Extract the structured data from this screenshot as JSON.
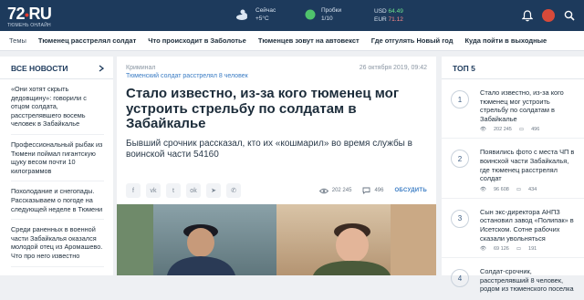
{
  "header": {
    "logo_num": "72",
    "logo_dot": "•",
    "logo_ru": "RU",
    "logo_sub": "ТЮМЕНЬ ОНЛАЙН",
    "weather_label": "Сейчас",
    "weather_temp": "+5°С",
    "traffic_label": "Пробки",
    "traffic_value": "1/10",
    "usd_label": "USD",
    "usd_value": "64.49",
    "eur_label": "EUR",
    "eur_value": "71.12"
  },
  "nav": [
    "Темы",
    "Тюменец расстрелял солдат",
    "Что происходит в Заболотье",
    "Тюменцев зовут на автовекст",
    "Где отгулять Новый год",
    "Куда пойти в выходные"
  ],
  "left": {
    "title": "ВСЕ НОВОСТИ",
    "items": [
      "«Они хотят скрыть дедовщину»: говорили с отцом солдата, расстрелявшего восемь человек в Забайкалье",
      "Профессиональный рыбак из Тюмени поймал гигантскую щуку весом почти 10 килограммов",
      "Похолодание и снегопады. Рассказываем о погоде на следующей неделе в Тюмени",
      "Среди раненных в военной части Забайкалья оказался молодой отец из Аромашево. Что про него известно"
    ]
  },
  "article": {
    "category": "Криминал",
    "date": "26 октября 2019, 09:42",
    "sublink": "Тюменский солдат расстрелял 8 человек",
    "headline": "Стало известно, из-за кого тюменец мог устроить стрельбу по солдатам в Забайкалье",
    "lead": "Бывший срочник рассказал, кто их «кошмарил» во время службы в воинской части 54160",
    "views": "202 245",
    "comments": "496",
    "discuss_label": "ОБСУДИТЬ"
  },
  "top5": {
    "title": "ТОП 5",
    "items": [
      {
        "num": "1",
        "text": "Стало известно, из-за кого тюменец мог устроить стрельбу по солдатам в Забайкалье",
        "views": "202 245",
        "comments": "496"
      },
      {
        "num": "2",
        "text": "Появились фото с места ЧП в воинской части Забайкалья, где тюменец расстрелял солдат",
        "views": "96 608",
        "comments": "434"
      },
      {
        "num": "3",
        "text": "Сын экс-директора АНПЗ остановил завод «Полипак» в Исетском. Сотне рабочих сказали увольняться",
        "views": "69 126",
        "comments": "191"
      },
      {
        "num": "4",
        "text": "Солдат-срочник, расстрелявший 8 человек, родом из тюменского поселка"
      }
    ]
  }
}
